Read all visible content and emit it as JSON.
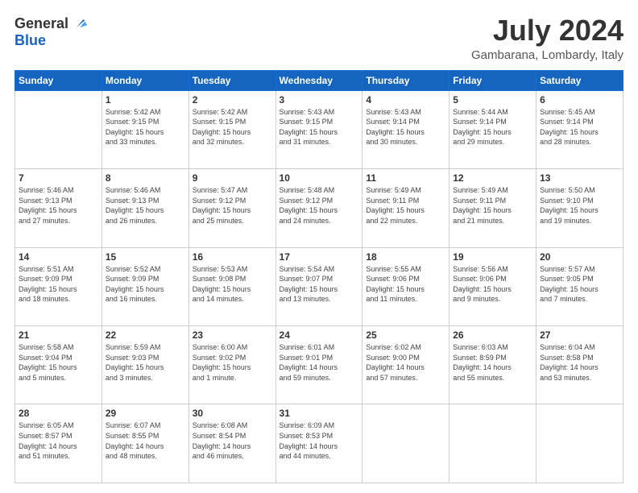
{
  "header": {
    "logo_general": "General",
    "logo_blue": "Blue",
    "main_title": "July 2024",
    "subtitle": "Gambarana, Lombardy, Italy"
  },
  "calendar": {
    "days_of_week": [
      "Sunday",
      "Monday",
      "Tuesday",
      "Wednesday",
      "Thursday",
      "Friday",
      "Saturday"
    ],
    "weeks": [
      [
        {
          "day": "",
          "info": ""
        },
        {
          "day": "1",
          "info": "Sunrise: 5:42 AM\nSunset: 9:15 PM\nDaylight: 15 hours\nand 33 minutes."
        },
        {
          "day": "2",
          "info": "Sunrise: 5:42 AM\nSunset: 9:15 PM\nDaylight: 15 hours\nand 32 minutes."
        },
        {
          "day": "3",
          "info": "Sunrise: 5:43 AM\nSunset: 9:15 PM\nDaylight: 15 hours\nand 31 minutes."
        },
        {
          "day": "4",
          "info": "Sunrise: 5:43 AM\nSunset: 9:14 PM\nDaylight: 15 hours\nand 30 minutes."
        },
        {
          "day": "5",
          "info": "Sunrise: 5:44 AM\nSunset: 9:14 PM\nDaylight: 15 hours\nand 29 minutes."
        },
        {
          "day": "6",
          "info": "Sunrise: 5:45 AM\nSunset: 9:14 PM\nDaylight: 15 hours\nand 28 minutes."
        }
      ],
      [
        {
          "day": "7",
          "info": "Sunrise: 5:46 AM\nSunset: 9:13 PM\nDaylight: 15 hours\nand 27 minutes."
        },
        {
          "day": "8",
          "info": "Sunrise: 5:46 AM\nSunset: 9:13 PM\nDaylight: 15 hours\nand 26 minutes."
        },
        {
          "day": "9",
          "info": "Sunrise: 5:47 AM\nSunset: 9:12 PM\nDaylight: 15 hours\nand 25 minutes."
        },
        {
          "day": "10",
          "info": "Sunrise: 5:48 AM\nSunset: 9:12 PM\nDaylight: 15 hours\nand 24 minutes."
        },
        {
          "day": "11",
          "info": "Sunrise: 5:49 AM\nSunset: 9:11 PM\nDaylight: 15 hours\nand 22 minutes."
        },
        {
          "day": "12",
          "info": "Sunrise: 5:49 AM\nSunset: 9:11 PM\nDaylight: 15 hours\nand 21 minutes."
        },
        {
          "day": "13",
          "info": "Sunrise: 5:50 AM\nSunset: 9:10 PM\nDaylight: 15 hours\nand 19 minutes."
        }
      ],
      [
        {
          "day": "14",
          "info": "Sunrise: 5:51 AM\nSunset: 9:09 PM\nDaylight: 15 hours\nand 18 minutes."
        },
        {
          "day": "15",
          "info": "Sunrise: 5:52 AM\nSunset: 9:09 PM\nDaylight: 15 hours\nand 16 minutes."
        },
        {
          "day": "16",
          "info": "Sunrise: 5:53 AM\nSunset: 9:08 PM\nDaylight: 15 hours\nand 14 minutes."
        },
        {
          "day": "17",
          "info": "Sunrise: 5:54 AM\nSunset: 9:07 PM\nDaylight: 15 hours\nand 13 minutes."
        },
        {
          "day": "18",
          "info": "Sunrise: 5:55 AM\nSunset: 9:06 PM\nDaylight: 15 hours\nand 11 minutes."
        },
        {
          "day": "19",
          "info": "Sunrise: 5:56 AM\nSunset: 9:06 PM\nDaylight: 15 hours\nand 9 minutes."
        },
        {
          "day": "20",
          "info": "Sunrise: 5:57 AM\nSunset: 9:05 PM\nDaylight: 15 hours\nand 7 minutes."
        }
      ],
      [
        {
          "day": "21",
          "info": "Sunrise: 5:58 AM\nSunset: 9:04 PM\nDaylight: 15 hours\nand 5 minutes."
        },
        {
          "day": "22",
          "info": "Sunrise: 5:59 AM\nSunset: 9:03 PM\nDaylight: 15 hours\nand 3 minutes."
        },
        {
          "day": "23",
          "info": "Sunrise: 6:00 AM\nSunset: 9:02 PM\nDaylight: 15 hours\nand 1 minute."
        },
        {
          "day": "24",
          "info": "Sunrise: 6:01 AM\nSunset: 9:01 PM\nDaylight: 14 hours\nand 59 minutes."
        },
        {
          "day": "25",
          "info": "Sunrise: 6:02 AM\nSunset: 9:00 PM\nDaylight: 14 hours\nand 57 minutes."
        },
        {
          "day": "26",
          "info": "Sunrise: 6:03 AM\nSunset: 8:59 PM\nDaylight: 14 hours\nand 55 minutes."
        },
        {
          "day": "27",
          "info": "Sunrise: 6:04 AM\nSunset: 8:58 PM\nDaylight: 14 hours\nand 53 minutes."
        }
      ],
      [
        {
          "day": "28",
          "info": "Sunrise: 6:05 AM\nSunset: 8:57 PM\nDaylight: 14 hours\nand 51 minutes."
        },
        {
          "day": "29",
          "info": "Sunrise: 6:07 AM\nSunset: 8:55 PM\nDaylight: 14 hours\nand 48 minutes."
        },
        {
          "day": "30",
          "info": "Sunrise: 6:08 AM\nSunset: 8:54 PM\nDaylight: 14 hours\nand 46 minutes."
        },
        {
          "day": "31",
          "info": "Sunrise: 6:09 AM\nSunset: 8:53 PM\nDaylight: 14 hours\nand 44 minutes."
        },
        {
          "day": "",
          "info": ""
        },
        {
          "day": "",
          "info": ""
        },
        {
          "day": "",
          "info": ""
        }
      ]
    ]
  }
}
